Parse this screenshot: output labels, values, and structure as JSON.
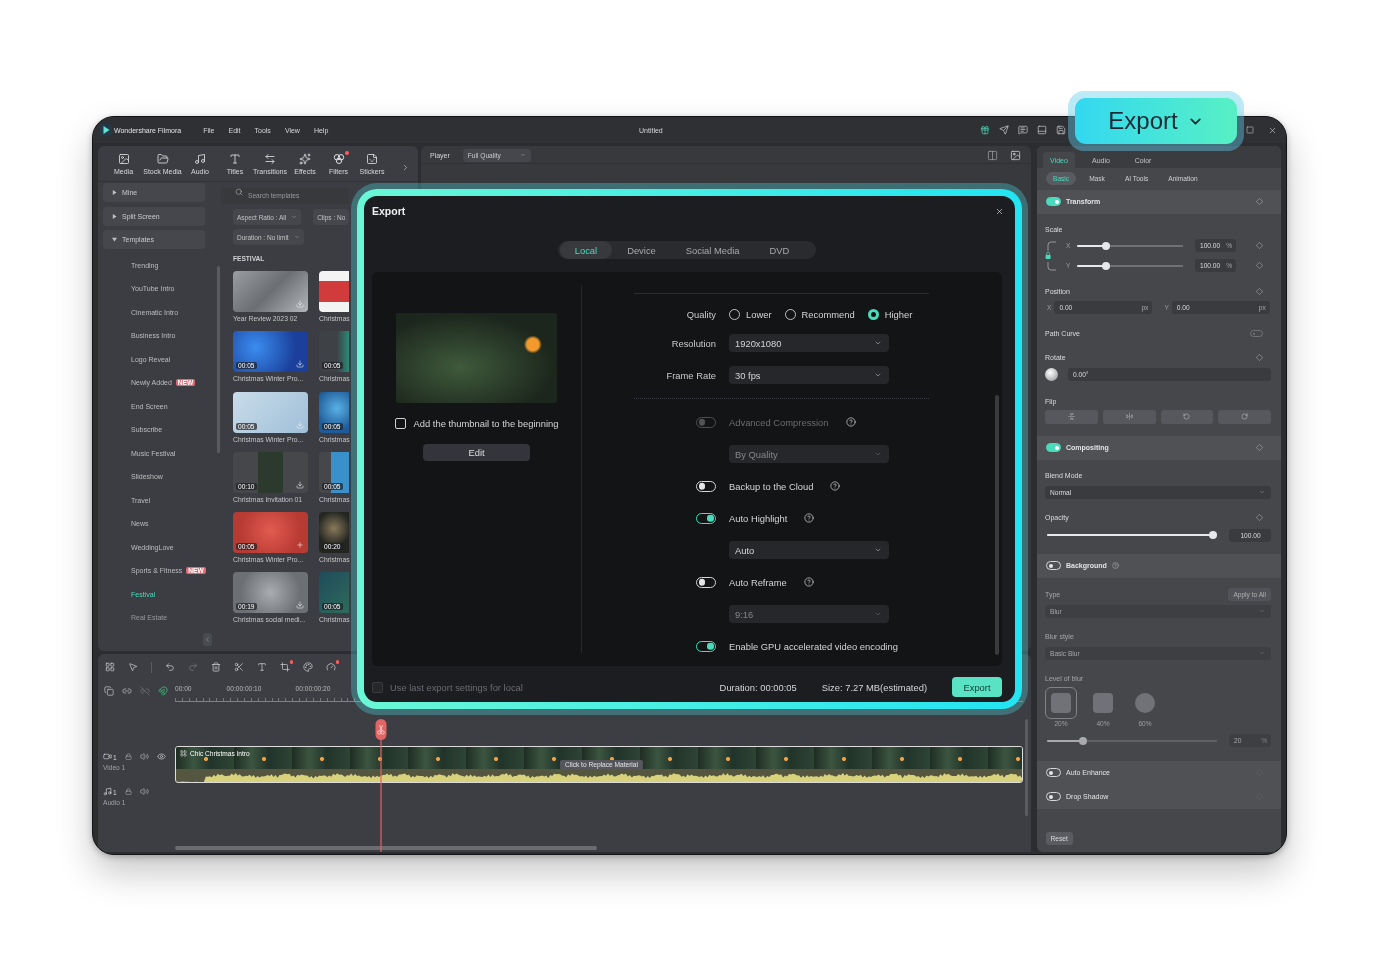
{
  "window": {
    "app_name": "Wondershare Filmora",
    "menu": [
      "File",
      "Edit",
      "Tools",
      "View",
      "Help"
    ],
    "title": "Untitled"
  },
  "media_toolbar": {
    "items": [
      {
        "label": "Media",
        "dot": false
      },
      {
        "label": "Stock Media",
        "dot": false
      },
      {
        "label": "Audio",
        "dot": false
      },
      {
        "label": "Titles",
        "dot": false
      },
      {
        "label": "Transitions",
        "dot": false
      },
      {
        "label": "Effects",
        "dot": false
      },
      {
        "label": "Filters",
        "dot": true
      },
      {
        "label": "Stickers",
        "dot": false
      }
    ]
  },
  "sidebar": {
    "items": [
      {
        "label": "Mine",
        "expanded": false
      },
      {
        "label": "Split Screen",
        "expanded": false
      },
      {
        "label": "Templates",
        "expanded": true,
        "children": [
          {
            "label": "Trending",
            "selected": false
          },
          {
            "label": "YouTube Intro",
            "selected": false
          },
          {
            "label": "Cinematic Intro",
            "selected": false
          },
          {
            "label": "Business Intro",
            "selected": false
          },
          {
            "label": "Logo Reveal",
            "selected": false
          },
          {
            "label": "Newly Added",
            "selected": false,
            "badge": "NEW"
          },
          {
            "label": "End Screen",
            "selected": false
          },
          {
            "label": "Subscribe",
            "selected": false
          },
          {
            "label": "Music Festival",
            "selected": false
          },
          {
            "label": "Slideshow",
            "selected": false
          },
          {
            "label": "Travel",
            "selected": false
          },
          {
            "label": "News",
            "selected": false
          },
          {
            "label": "WeddingLove",
            "selected": false
          },
          {
            "label": "Sports & Fitness",
            "selected": false,
            "badge": "NEW"
          },
          {
            "label": "Festival",
            "selected": true
          },
          {
            "label": "Real Estate",
            "selected": false
          }
        ]
      }
    ]
  },
  "templates": {
    "search": {
      "placeholder": "Search templates"
    },
    "filters": [
      {
        "label": "Aspect Ratio : All",
        "caret": true
      },
      {
        "label": "Clips : No",
        "caret": false
      },
      {
        "label": "Duration : No limit",
        "caret": true
      }
    ],
    "section": "FESTIVAL",
    "rows": [
      {
        "cards": [
          {
            "title": "Year Review 2023 02",
            "downloaded": false
          },
          {
            "title": "Christmas"
          }
        ]
      },
      {
        "cards": [
          {
            "title": "Christmas Winter Pro...",
            "duration": "00:05",
            "downloaded": false
          },
          {
            "title": "Christmas",
            "duration": "00:05"
          }
        ]
      },
      {
        "cards": [
          {
            "title": "Christmas Winter Pro...",
            "duration": "00:05",
            "downloaded": false
          },
          {
            "title": "Christmas",
            "duration": "00:05"
          }
        ]
      },
      {
        "cards": [
          {
            "title": "Christmas Invitation 01",
            "duration": "00:10",
            "downloaded": false
          },
          {
            "title": "Christmas",
            "duration": "00:05"
          }
        ]
      },
      {
        "cards": [
          {
            "title": "Christmas Winter Pro...",
            "duration": "00:05",
            "downloaded": true
          },
          {
            "title": "Christmas",
            "duration": "00:20"
          }
        ]
      },
      {
        "cards": [
          {
            "title": "Christmas social medi...",
            "duration": "00:19",
            "downloaded": false
          },
          {
            "title": "Christmas",
            "duration": "00:05"
          }
        ]
      }
    ]
  },
  "player": {
    "label": "Player",
    "quality": "Full Quality"
  },
  "timeline": {
    "tools": [
      {
        "dot": false,
        "disabled": false
      },
      {
        "dot": false,
        "disabled": false
      },
      {
        "dot": false,
        "disabled": false
      },
      {
        "dot": false,
        "disabled": true
      },
      {
        "dot": false,
        "disabled": false
      },
      {
        "dot": false,
        "disabled": false
      },
      {
        "dot": false,
        "disabled": false
      },
      {
        "dot": true,
        "disabled": false
      },
      {
        "dot": false,
        "disabled": false
      },
      {
        "dot": true,
        "disabled": false
      }
    ],
    "track_tools": [
      {
        "on": false,
        "disabled": false
      },
      {
        "on": false,
        "disabled": false
      },
      {
        "on": false,
        "disabled": true
      },
      {
        "on": true,
        "disabled": false
      }
    ],
    "ruler": [
      "00:00",
      "00:00:00:10",
      "00:00:00:20"
    ],
    "tracks": [
      {
        "kind": "video",
        "number": "1",
        "name": "Video 1",
        "clip": {
          "title": "Chic Christmas Intro",
          "tooltip": "Click to Replace Material"
        }
      },
      {
        "kind": "audio",
        "number": "1",
        "name": "Audio 1"
      }
    ]
  },
  "properties": {
    "tabs": [
      {
        "label": "Video",
        "selected": true
      },
      {
        "label": "Audio",
        "selected": false
      },
      {
        "label": "Color",
        "selected": false
      }
    ],
    "subtabs": [
      {
        "label": "Basic",
        "selected": true
      },
      {
        "label": "Mask",
        "selected": false
      },
      {
        "label": "AI Tools",
        "selected": false
      },
      {
        "label": "Animation",
        "selected": false
      }
    ],
    "transform": {
      "title": "Transform",
      "on": true,
      "scale": {
        "label": "Scale",
        "axes": [
          {
            "axis": "X",
            "level": 0.26,
            "value": "100.00",
            "unit": "%"
          },
          {
            "axis": "Y",
            "level": 0.26,
            "value": "100.00",
            "unit": "%"
          }
        ]
      },
      "position": {
        "label": "Position",
        "axes": [
          {
            "axis": "X",
            "value": "0.00",
            "unit": "px"
          },
          {
            "axis": "Y",
            "value": "0.00",
            "unit": "px"
          }
        ]
      },
      "path_curve": {
        "label": "Path Curve",
        "on": false,
        "disabled": true
      },
      "rotate": {
        "label": "Rotate",
        "value": "0.00°"
      },
      "flip": {
        "label": "Flip"
      }
    },
    "compositing": {
      "title": "Compositing",
      "on": true,
      "blend_mode": {
        "label": "Blend Mode",
        "value": "Normal"
      },
      "opacity": {
        "label": "Opacity",
        "level": 1,
        "value": "100.00"
      }
    },
    "background": {
      "title": "Background",
      "on": false,
      "type": {
        "label": "Type",
        "value": "Blur",
        "button": "Apply to All"
      },
      "blur_style": {
        "label": "Blur style",
        "value": "Basic Blur"
      },
      "blur_level": {
        "label": "Level of blur",
        "options": [
          {
            "label": "20%",
            "selected": true
          },
          {
            "label": "40%",
            "selected": false
          },
          {
            "label": "60%",
            "selected": false
          }
        ],
        "level": 0.2,
        "value": "20",
        "unit": "%"
      }
    },
    "extras": [
      {
        "label": "Auto Enhance",
        "on": false
      },
      {
        "label": "Drop Shadow",
        "on": false
      }
    ],
    "reset": "Reset"
  },
  "export_dialog": {
    "title": "Export",
    "tabs": [
      {
        "label": "Local",
        "selected": true
      },
      {
        "label": "Device",
        "selected": false
      },
      {
        "label": "Social Media",
        "selected": false
      },
      {
        "label": "DVD",
        "selected": false
      }
    ],
    "thumbnail_checkbox": {
      "label": "Add the thumbnail to the beginning",
      "checked": false
    },
    "edit_button": "Edit",
    "quality": {
      "label": "Quality",
      "options": [
        {
          "label": "Lower",
          "selected": false
        },
        {
          "label": "Recommend",
          "selected": false
        },
        {
          "label": "Higher",
          "selected": true
        }
      ]
    },
    "resolution": {
      "label": "Resolution",
      "value": "1920x1080"
    },
    "frame_rate": {
      "label": "Frame Rate",
      "value": "30 fps"
    },
    "options": [
      {
        "kind": "toggle",
        "label": "Advanced Compression",
        "on": false,
        "disabled": true,
        "help": true
      },
      {
        "kind": "select",
        "value": "By Quality",
        "disabled": true
      },
      {
        "kind": "toggle",
        "label": "Backup to the Cloud",
        "on": false,
        "disabled": false,
        "help": true
      },
      {
        "kind": "toggle",
        "label": "Auto Highlight",
        "on": true,
        "disabled": false,
        "help": true
      },
      {
        "kind": "select",
        "value": "Auto",
        "disabled": false
      },
      {
        "kind": "toggle",
        "label": "Auto Reframe",
        "on": false,
        "disabled": false,
        "help": true
      },
      {
        "kind": "select",
        "value": "9:16",
        "disabled": true
      },
      {
        "kind": "toggle",
        "label": "Enable GPU accelerated video encoding",
        "on": true,
        "disabled": false,
        "help": false
      }
    ],
    "footer": {
      "checkbox": {
        "label": "Use last export settings for local",
        "checked": false,
        "disabled": true
      },
      "duration": "Duration: 00:00:05",
      "size": "Size: 7.27 MB(estimated)",
      "button": "Export"
    }
  },
  "export_callout": {
    "label": "Export"
  }
}
